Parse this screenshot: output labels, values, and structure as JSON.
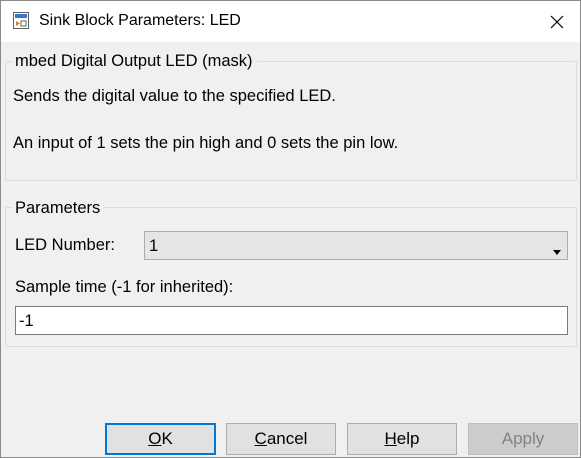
{
  "window": {
    "title": "Sink Block Parameters: LED",
    "app_icon": "simulink-block-icon",
    "close_icon": "close-icon"
  },
  "description_group": {
    "legend": "mbed Digital Output LED (mask)",
    "line1": "Sends the digital value to the specified LED.",
    "line2": "An input of 1 sets the pin high and 0 sets the pin low."
  },
  "parameters_group": {
    "legend": "Parameters",
    "led_number": {
      "label": "LED Number:",
      "selected": "1"
    },
    "sample_time": {
      "label": "Sample time (-1 for inherited):",
      "value": "-1"
    }
  },
  "buttons": {
    "ok": {
      "mnemonic": "O",
      "rest": "K"
    },
    "cancel": {
      "mnemonic": "C",
      "rest": "ancel"
    },
    "help": {
      "mnemonic": "H",
      "rest": "elp"
    },
    "apply": {
      "label": "Apply",
      "enabled": false
    }
  },
  "colors": {
    "default_button_border": "#0078d7",
    "dialog_background": "#f0f0f0",
    "disabled_text": "#838383"
  }
}
